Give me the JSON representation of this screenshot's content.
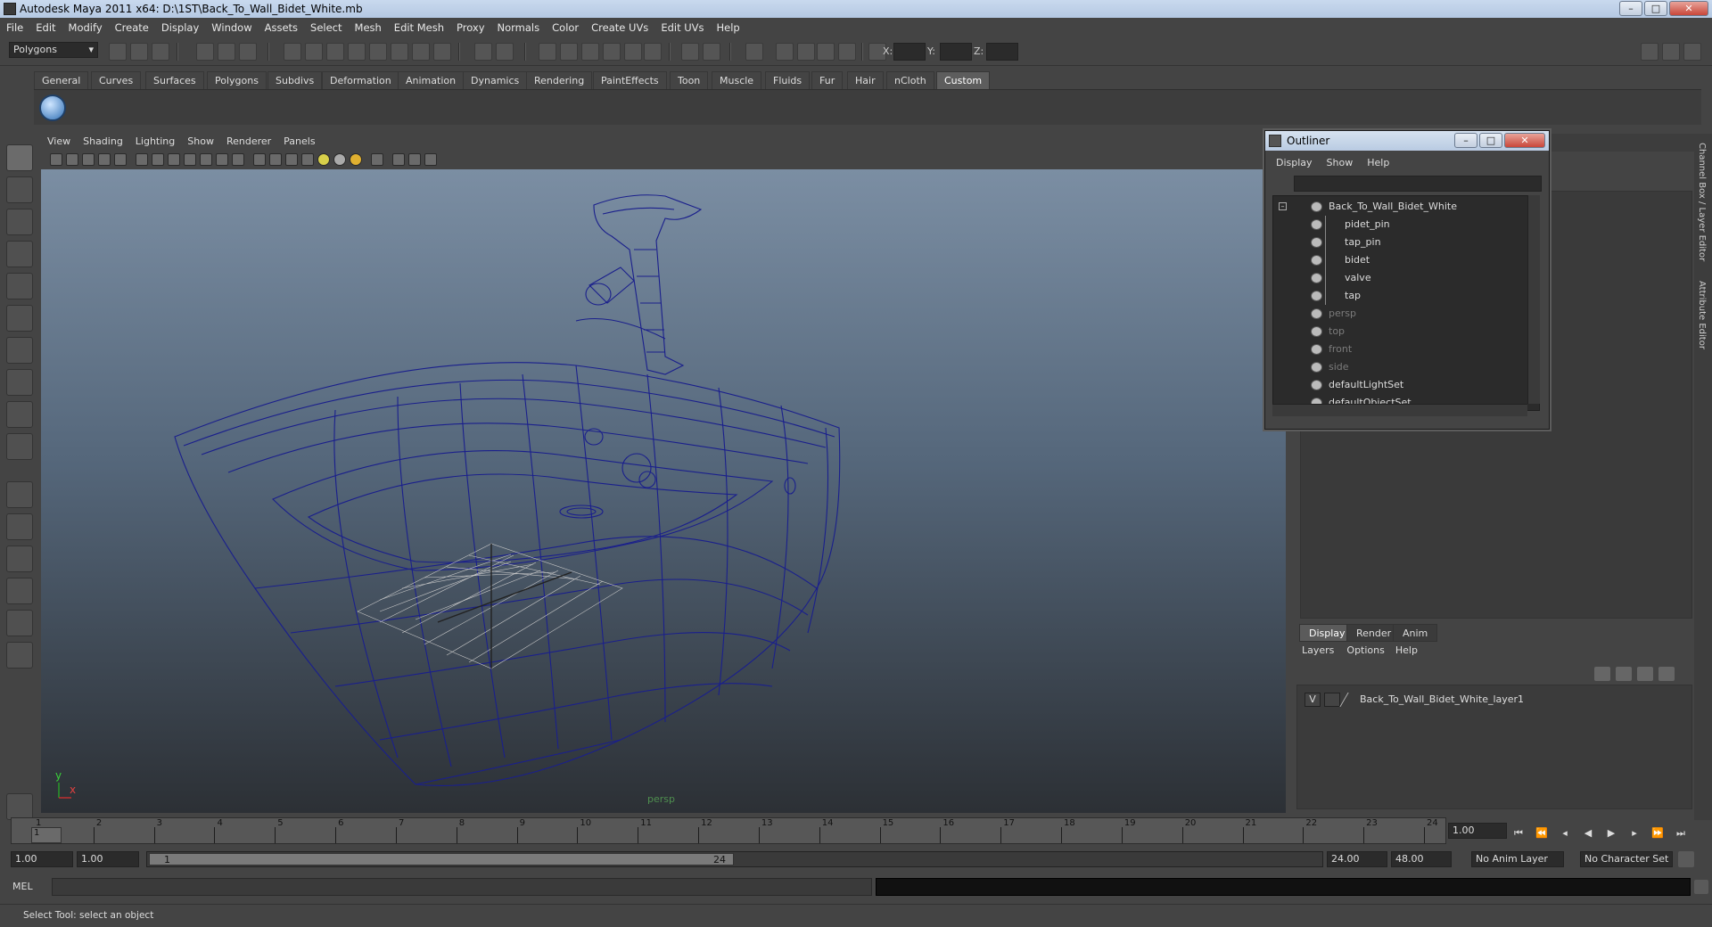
{
  "window": {
    "title": "Autodesk Maya 2011 x64: D:\\1ST\\Back_To_Wall_Bidet_White.mb"
  },
  "menu": [
    "File",
    "Edit",
    "Modify",
    "Create",
    "Display",
    "Window",
    "Assets",
    "Select",
    "Mesh",
    "Edit Mesh",
    "Proxy",
    "Normals",
    "Color",
    "Create UVs",
    "Edit UVs",
    "Help"
  ],
  "status": {
    "mode": "Polygons",
    "x_label": "X:",
    "y_label": "Y:",
    "z_label": "Z:"
  },
  "shelf": {
    "tabs": [
      "General",
      "Curves",
      "Surfaces",
      "Polygons",
      "Subdivs",
      "Deformation",
      "Animation",
      "Dynamics",
      "Rendering",
      "PaintEffects",
      "Toon",
      "Muscle",
      "Fluids",
      "Fur",
      "Hair",
      "nCloth",
      "Custom"
    ],
    "active": "Custom"
  },
  "viewport": {
    "menu": [
      "View",
      "Shading",
      "Lighting",
      "Show",
      "Renderer",
      "Panels"
    ],
    "camera_label": "persp",
    "axis_y": "y",
    "axis_x": "x"
  },
  "outliner": {
    "title": "Outliner",
    "menu": [
      "Display",
      "Show",
      "Help"
    ],
    "items": [
      {
        "label": "Back_To_Wall_Bidet_White",
        "dim": false,
        "indent": 0
      },
      {
        "label": "pidet_pin",
        "dim": false,
        "indent": 1
      },
      {
        "label": "tap_pin",
        "dim": false,
        "indent": 1
      },
      {
        "label": "bidet",
        "dim": false,
        "indent": 1
      },
      {
        "label": "valve",
        "dim": false,
        "indent": 1
      },
      {
        "label": "tap",
        "dim": false,
        "indent": 1
      },
      {
        "label": "persp",
        "dim": true,
        "indent": 0
      },
      {
        "label": "top",
        "dim": true,
        "indent": 0
      },
      {
        "label": "front",
        "dim": true,
        "indent": 0
      },
      {
        "label": "side",
        "dim": true,
        "indent": 0
      },
      {
        "label": "defaultLightSet",
        "dim": false,
        "indent": 0
      },
      {
        "label": "defaultObjectSet",
        "dim": false,
        "indent": 0
      }
    ]
  },
  "layers": {
    "tabs": [
      "Display",
      "Render",
      "Anim"
    ],
    "active": "Display",
    "menu": [
      "Layers",
      "Options",
      "Help"
    ],
    "layer": {
      "visible": "V",
      "name": "Back_To_Wall_Bidet_White_layer1"
    }
  },
  "side_tabs": [
    "Channel Box / Layer Editor",
    "Attribute Editor"
  ],
  "time": {
    "ticks": [
      "1",
      "2",
      "3",
      "4",
      "5",
      "6",
      "7",
      "8",
      "9",
      "10",
      "11",
      "12",
      "13",
      "14",
      "15",
      "16",
      "17",
      "18",
      "19",
      "20",
      "21",
      "22",
      "23",
      "24"
    ],
    "current_frame": "1.00",
    "start": "1.00",
    "start2": "1.00",
    "range_start": "1",
    "range_end": "24",
    "end": "24.00",
    "end2": "48.00",
    "anim_layer": "No Anim Layer",
    "char_set": "No Character Set",
    "marker": "1"
  },
  "mel": {
    "label": "MEL"
  },
  "help": {
    "text": "Select Tool: select an object"
  }
}
